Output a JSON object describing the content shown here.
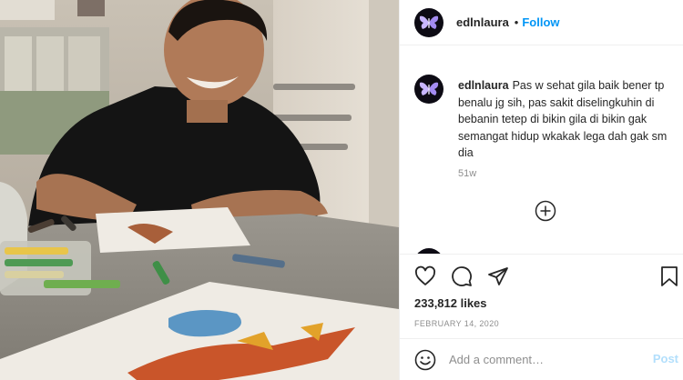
{
  "post": {
    "username": "edlnlaura",
    "separator": "•",
    "follow_label": "Follow",
    "avatar_icon": "butterfly-icon"
  },
  "caption": {
    "username": "edlnlaura",
    "text": "Pas w sehat gila baik bener tp benalu jg sih, pas sakit diselingkuhin di bebanin tetep di bikin gila di bikin gak semangat hidup wkakak lega dah gak sm dia",
    "age": "51w"
  },
  "actions": {
    "like_icon": "heart-icon",
    "comment_icon": "comment-icon",
    "share_icon": "share-icon",
    "save_icon": "bookmark-icon",
    "load_more_icon": "plus-circle-icon"
  },
  "likes": "233,812 likes",
  "date": "FEBRUARY 14, 2020",
  "comment_box": {
    "placeholder": "Add a comment…",
    "post_label": "Post",
    "emoji_icon": "smiley-icon"
  },
  "colors": {
    "accent": "#0095f6",
    "post_disabled": "#b2dffc",
    "muted": "#8e8e8e",
    "avatar_bg": "#0d0b14"
  }
}
